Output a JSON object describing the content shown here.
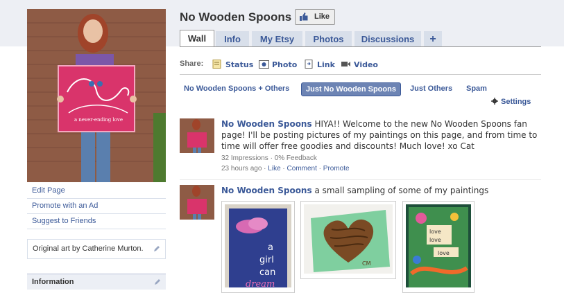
{
  "page": {
    "title": "No Wooden Spoons",
    "like_label": "Like"
  },
  "tabs": [
    {
      "label": "Wall",
      "active": true
    },
    {
      "label": "Info",
      "active": false
    },
    {
      "label": "My Etsy",
      "active": false
    },
    {
      "label": "Photos",
      "active": false
    },
    {
      "label": "Discussions",
      "active": false
    },
    {
      "label": "+",
      "active": false
    }
  ],
  "sidebar": {
    "links": [
      "Edit Page",
      "Promote with an Ad",
      "Suggest to Friends"
    ],
    "bio": "Original art by Catherine Murton.",
    "info_heading": "Information",
    "photo_text": "a never-ending love"
  },
  "share": {
    "label": "Share:",
    "items": [
      {
        "label": "Status",
        "icon": "status-icon"
      },
      {
        "label": "Photo",
        "icon": "photo-icon"
      },
      {
        "label": "Link",
        "icon": "link-icon"
      },
      {
        "label": "Video",
        "icon": "video-icon"
      }
    ]
  },
  "filters": [
    {
      "label": "No Wooden Spoons + Others",
      "active": false
    },
    {
      "label": "Just No Wooden Spoons",
      "active": true
    },
    {
      "label": "Just Others",
      "active": false
    },
    {
      "label": "Spam",
      "active": false
    }
  ],
  "settings_label": "Settings",
  "posts": [
    {
      "author": "No Wooden Spoons",
      "text": " HIYA!! Welcome to the new No Wooden Spoons fan page! I'll be posting pictures of my paintings on this page, and from time to time will offer free goodies and discounts! Much love! xo Cat",
      "stats": "32 Impressions · 0% Feedback",
      "time": "23 hours ago",
      "sep1": " · ",
      "like": "Like",
      "sep2": " · ",
      "comment": "Comment",
      "sep3": " · ",
      "promote": "Promote"
    },
    {
      "author": "No Wooden Spoons",
      "text": " a small sampling of some of my paintings"
    }
  ],
  "paintings": [
    {
      "text_line1": "a",
      "text_line2": "girl",
      "text_line3": "can",
      "text_line4": "dream"
    },
    {
      "signature": "CM"
    },
    {
      "text_line1": "love",
      "text_line2": "love",
      "text_line3": "love"
    }
  ],
  "colors": {
    "link": "#3b5998",
    "tab_bg": "#d8dfea",
    "header_bg": "#edeff4",
    "filter_active": "#6d84b4"
  }
}
